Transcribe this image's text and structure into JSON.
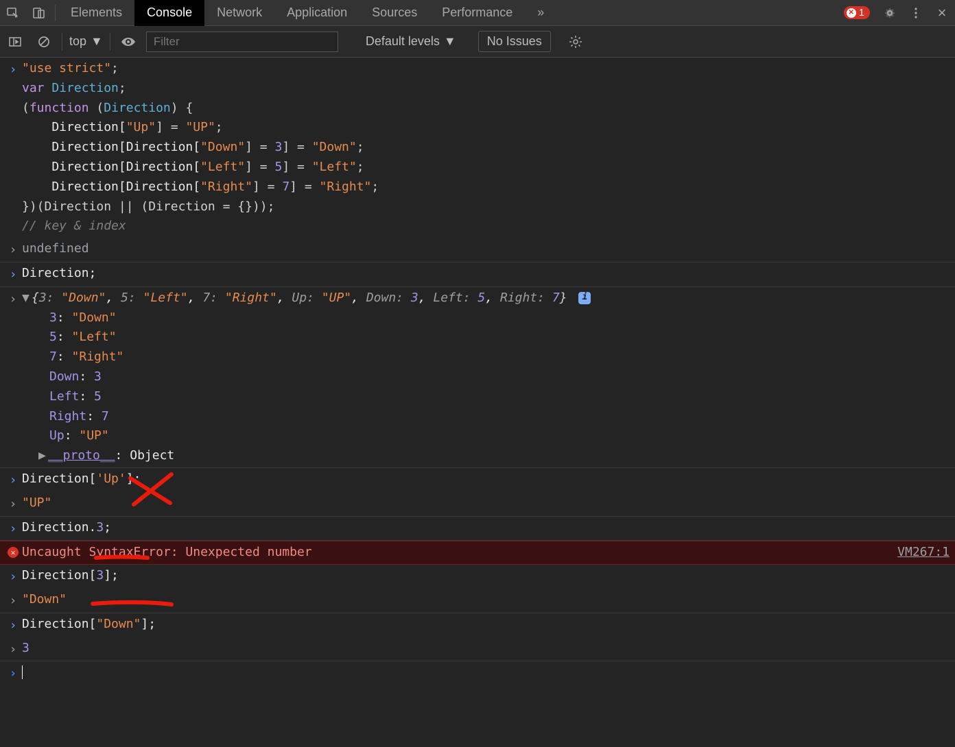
{
  "tabs": {
    "elements": "Elements",
    "console": "Console",
    "network": "Network",
    "application": "Application",
    "sources": "Sources",
    "performance": "Performance",
    "more": "»"
  },
  "error_count": "1",
  "toolbar": {
    "context": "top",
    "filter_placeholder": "Filter",
    "levels": "Default levels",
    "no_issues": "No Issues"
  },
  "code1": {
    "l1_str": "\"use strict\"",
    "l1_semi": ";",
    "l2_var": "var",
    "l2_name": "Direction",
    "l2_semi": ";",
    "l3_open": "(",
    "l3_fn": "function",
    "l3_sp": " (",
    "l3_param": "Direction",
    "l3_close": ") {",
    "l4": "    Direction[",
    "l4_k": "\"Up\"",
    "l4_b": "] = ",
    "l4_v": "\"UP\"",
    "l4_e": ";",
    "l5a": "    Direction[Direction[",
    "l5_k": "\"Down\"",
    "l5_b": "] = ",
    "l5_n": "3",
    "l5_c": "] = ",
    "l5_v": "\"Down\"",
    "l5_e": ";",
    "l6a": "    Direction[Direction[",
    "l6_k": "\"Left\"",
    "l6_b": "] = ",
    "l6_n": "5",
    "l6_c": "] = ",
    "l6_v": "\"Left\"",
    "l6_e": ";",
    "l7a": "    Direction[Direction[",
    "l7_k": "\"Right\"",
    "l7_b": "] = ",
    "l7_n": "7",
    "l7_c": "] = ",
    "l7_v": "\"Right\"",
    "l7_e": ";",
    "l8": "})(Direction || (Direction = {}));",
    "l9": "// key & index"
  },
  "out1": "undefined",
  "in2": "Direction;",
  "obj_summary": {
    "open": "{",
    "p1k": "3:",
    "p1v": "\"Down\"",
    "p2k": "5:",
    "p2v": "\"Left\"",
    "p3k": "7:",
    "p3v": "\"Right\"",
    "p4k": "Up:",
    "p4v": "\"UP\"",
    "p5k": "Down:",
    "p5v": "3",
    "p6k": "Left:",
    "p6v": "5",
    "p7k": "Right:",
    "p7v": "7",
    "close": "}"
  },
  "obj_expand": {
    "r1k": "3",
    "r1v": "\"Down\"",
    "r2k": "5",
    "r2v": "\"Left\"",
    "r3k": "7",
    "r3v": "\"Right\"",
    "r4k": "Down",
    "r4v": "3",
    "r5k": "Left",
    "r5v": "5",
    "r6k": "Right",
    "r6v": "7",
    "r7k": "Up",
    "r7v": "\"UP\"",
    "proto_k": "__proto__",
    "proto_v": "Object"
  },
  "in3": "Direction['Up'];",
  "in3_pre": "Direction[",
  "in3_key": "'Up'",
  "in3_post": "];",
  "out3": "\"UP\"",
  "in4_pre": "Direction.",
  "in4_num": "3",
  "in4_post": ";",
  "err": {
    "msg": "Uncaught SyntaxError: Unexpected number",
    "src": "VM267:1"
  },
  "in5_pre": "Direction[",
  "in5_num": "3",
  "in5_post": "];",
  "out5": "\"Down\"",
  "in6_pre": "Direction[",
  "in6_key": "\"Down\"",
  "in6_post": "];",
  "out6": "3",
  "info_i": "i"
}
